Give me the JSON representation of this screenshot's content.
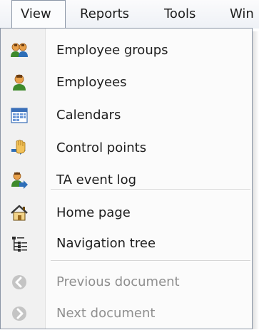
{
  "menubar": {
    "items": [
      {
        "label": "View"
      },
      {
        "label": "Reports"
      },
      {
        "label": "Tools"
      },
      {
        "label": "Win"
      }
    ]
  },
  "view_menu": {
    "groups": [
      [
        {
          "label": "Employee groups",
          "icon": "employee-groups-icon",
          "enabled": true
        },
        {
          "label": "Employees",
          "icon": "employee-icon",
          "enabled": true
        },
        {
          "label": "Calendars",
          "icon": "calendar-icon",
          "enabled": true
        },
        {
          "label": "Control points",
          "icon": "control-point-hand-icon",
          "enabled": true
        },
        {
          "label": "TA event log",
          "icon": "event-log-icon",
          "enabled": true
        }
      ],
      [
        {
          "label": "Home page",
          "icon": "home-icon",
          "enabled": true
        },
        {
          "label": "Navigation tree",
          "icon": "navigation-tree-icon",
          "enabled": true
        }
      ],
      [
        {
          "label": "Previous document",
          "icon": "back-arrow-icon",
          "enabled": false
        },
        {
          "label": "Next document",
          "icon": "forward-arrow-icon",
          "enabled": false
        }
      ]
    ]
  },
  "colors": {
    "menu_background": "#fbfbfb",
    "icon_gutter": "#f1f1f1",
    "border": "#8b96a6",
    "disabled_text": "#8f8f8f"
  }
}
